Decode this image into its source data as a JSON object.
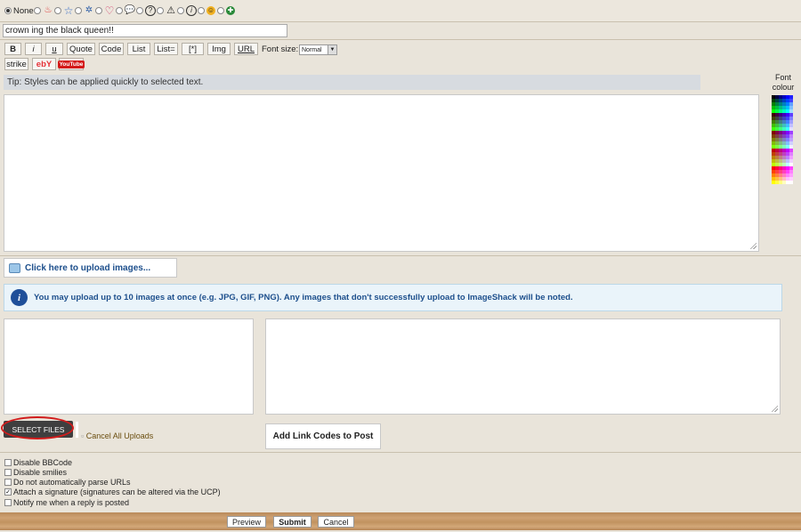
{
  "icons": {
    "none_label": "None",
    "items": [
      "fire-icon",
      "star-icon",
      "recycle-icon",
      "heart-icon",
      "speech-bubble-icon",
      "question-icon",
      "warning-icon",
      "info-icon",
      "smiley-icon",
      "thumbs-icon"
    ]
  },
  "subject": {
    "value": "crown ing the black queen!!"
  },
  "toolbar": {
    "bold": "B",
    "italic": "i",
    "underline": "u",
    "quote": "Quote",
    "code": "Code",
    "list": "List",
    "list_ordered": "List=",
    "list_item": "[*]",
    "img": "Img",
    "url": "URL",
    "font_size_label": "Font size:",
    "font_size_value": "Normal",
    "strike": "strike",
    "ebay": "ebY",
    "youtube": "YouTube"
  },
  "tip": "Tip: Styles can be applied quickly to selected text.",
  "font_colour_label_1": "Font",
  "font_colour_label_2": "colour",
  "palette_colors": [
    "#000000",
    "#000040",
    "#000080",
    "#0000bf",
    "#0000ff",
    "#2020ff",
    "#004000",
    "#004040",
    "#004080",
    "#0040bf",
    "#0040ff",
    "#4040ff",
    "#008000",
    "#008040",
    "#008080",
    "#0080bf",
    "#0080ff",
    "#60a0ff",
    "#00bf00",
    "#00bf40",
    "#00bf80",
    "#00bfbf",
    "#00bfff",
    "#80c0ff",
    "#00ff00",
    "#00ff40",
    "#00ff80",
    "#00ffbf",
    "#00ffff",
    "#a0e0ff",
    "#400000",
    "#400040",
    "#400080",
    "#4000bf",
    "#4000ff",
    "#6040ff",
    "#404000",
    "#404040",
    "#404080",
    "#4040bf",
    "#4040ff",
    "#8080ff",
    "#408000",
    "#408040",
    "#408080",
    "#4080bf",
    "#4080ff",
    "#a0a0ff",
    "#40bf00",
    "#40bf40",
    "#40bf80",
    "#40bfbf",
    "#40bfff",
    "#c0c0ff",
    "#40ff00",
    "#40ff40",
    "#40ff80",
    "#40ffbf",
    "#40ffff",
    "#e0e0ff",
    "#800000",
    "#800040",
    "#800080",
    "#8000bf",
    "#8000ff",
    "#a040ff",
    "#804000",
    "#804040",
    "#804080",
    "#8040bf",
    "#8040ff",
    "#c080ff",
    "#808000",
    "#808040",
    "#808080",
    "#8080bf",
    "#8080ff",
    "#c0a0ff",
    "#80bf00",
    "#80bf40",
    "#80bf80",
    "#80bfbf",
    "#80bfff",
    "#d0d0ff",
    "#80ff00",
    "#80ff40",
    "#80ff80",
    "#80ffbf",
    "#80ffff",
    "#f0f0ff",
    "#bf0000",
    "#bf0040",
    "#bf0080",
    "#bf00bf",
    "#bf00ff",
    "#e040ff",
    "#bf4000",
    "#bf4040",
    "#bf4080",
    "#bf40bf",
    "#bf40ff",
    "#e080ff",
    "#bf8000",
    "#bf8040",
    "#bf8080",
    "#bf80bf",
    "#bf80ff",
    "#f0a0ff",
    "#bfbf00",
    "#bfbf40",
    "#bfbf80",
    "#bfbfbf",
    "#bfbfff",
    "#f0d0ff",
    "#bfff00",
    "#bfff40",
    "#bfff80",
    "#bfffbf",
    "#bfffff",
    "#ffffff",
    "#ff0000",
    "#ff0040",
    "#ff0080",
    "#ff00bf",
    "#ff00ff",
    "#ff40ff",
    "#ff4000",
    "#ff4040",
    "#ff4080",
    "#ff40bf",
    "#ff40ff",
    "#ff80ff",
    "#ff8000",
    "#ff8040",
    "#ff8080",
    "#ff80bf",
    "#ff80ff",
    "#ffa0ff",
    "#ffbf00",
    "#ffbf40",
    "#ffbf80",
    "#ffbfbf",
    "#ffbfff",
    "#ffd0ff",
    "#ffff00",
    "#ffff40",
    "#ffff80",
    "#ffffbf",
    "#ffffff",
    "#ffffff"
  ],
  "upload": {
    "link_text": "Click here to upload images...",
    "info_text": "You may upload up to 10 images at once (e.g. JPG, GIF, PNG). Any images that don't successfully upload to ImageShack will be noted.",
    "select_files": "SELECT FILES",
    "cancel_all": "Cancel All Uploads",
    "add_link_codes": "Add Link Codes to Post"
  },
  "options": [
    {
      "label": "Disable BBCode",
      "checked": false
    },
    {
      "label": "Disable smilies",
      "checked": false
    },
    {
      "label": "Do not automatically parse URLs",
      "checked": false
    },
    {
      "label": "Attach a signature (signatures can be altered via the UCP)",
      "checked": true
    },
    {
      "label": "Notify me when a reply is posted",
      "checked": false
    }
  ],
  "footer": {
    "preview": "Preview",
    "submit": "Submit",
    "cancel": "Cancel"
  }
}
